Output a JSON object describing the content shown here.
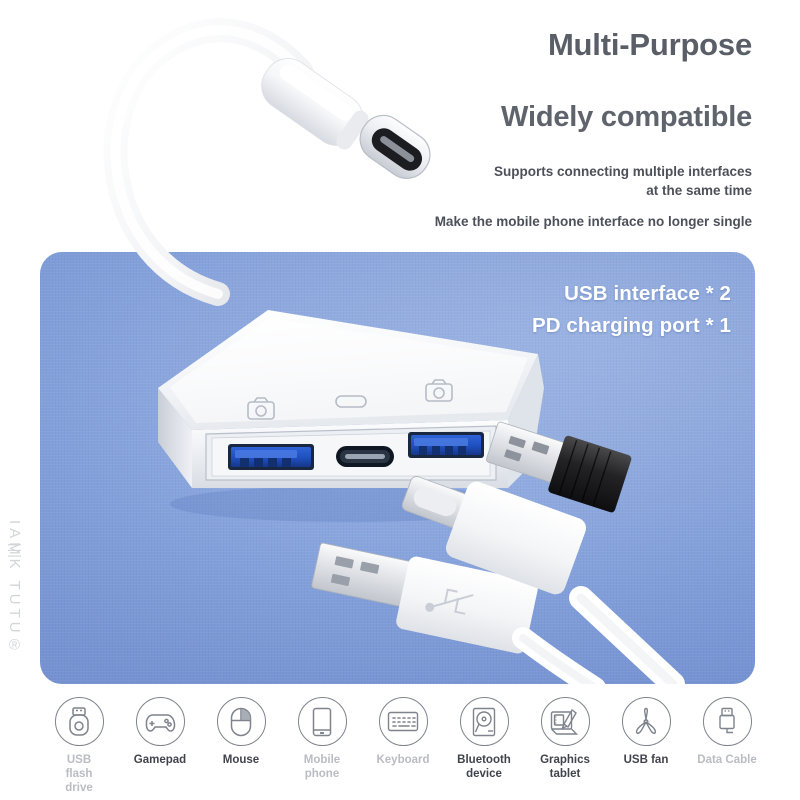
{
  "headline": {
    "line1": "Multi-Purpose",
    "line2": "Widely compatible",
    "note_line1": "Supports connecting multiple interfaces",
    "note_line2": "at the same time",
    "note2": "Make the mobile phone interface no longer single"
  },
  "features": {
    "usb_ports": "USB interface * 2",
    "pd_port": "PD charging port * 1"
  },
  "watermark": {
    "brand": "IAMK TUTU®",
    "mark": "|||"
  },
  "colors": {
    "panel_blue": "#7E9DDC",
    "heading_gray": "#595E67",
    "usb_blue": "#1F4FBF",
    "body_white": "#FFFFFF",
    "icon_gray": "#7E838C",
    "label_dark": "#3F434B",
    "label_dim": "#B9BCC2"
  },
  "compatibility": [
    {
      "icon": "usb-flash-drive-icon",
      "label": "USB\nflash\ndrive",
      "label_lines": [
        "USB",
        "flash",
        "drive"
      ],
      "tone": "dim"
    },
    {
      "icon": "gamepad-icon",
      "label": "Gamepad",
      "label_lines": [
        "Gamepad"
      ],
      "tone": "dark"
    },
    {
      "icon": "mouse-icon",
      "label": "Mouse",
      "label_lines": [
        "Mouse"
      ],
      "tone": "dark"
    },
    {
      "icon": "mobile-phone-icon",
      "label": "Mobile phone",
      "label_lines": [
        "Mobile",
        "phone"
      ],
      "tone": "dim"
    },
    {
      "icon": "keyboard-icon",
      "label": "Keyboard",
      "label_lines": [
        "Keyboard"
      ],
      "tone": "dim"
    },
    {
      "icon": "bluetooth-device-icon",
      "label": "Bluetooth device",
      "label_lines": [
        "Bluetooth",
        "device"
      ],
      "tone": "dark"
    },
    {
      "icon": "graphics-tablet-icon",
      "label": "Graphics tablet",
      "label_lines": [
        "Graphics",
        "tablet"
      ],
      "tone": "dark"
    },
    {
      "icon": "usb-fan-icon",
      "label": "USB fan",
      "label_lines": [
        "USB fan"
      ],
      "tone": "dark"
    },
    {
      "icon": "data-cable-icon",
      "label": "Data Cable",
      "label_lines": [
        "Data Cable"
      ],
      "tone": "dim"
    }
  ],
  "product": {
    "type": "usb-c-hub",
    "port_icons": [
      "camera-icon",
      "usb-c-icon",
      "camera-icon"
    ],
    "connectors": [
      "usb-a-male-plug",
      "usb-c-male-plug",
      "usb-dongle-black"
    ]
  }
}
